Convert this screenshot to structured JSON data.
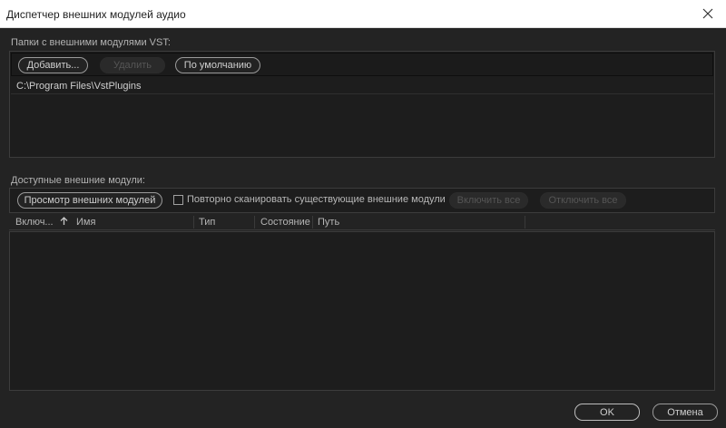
{
  "window": {
    "title": "Диспетчер внешних модулей аудио",
    "close_icon": "close-icon"
  },
  "vst_folders": {
    "label": "Папки с внешними модулями VST:",
    "buttons": {
      "add": "Добавить...",
      "remove": "Удалить",
      "default": "По умолчанию"
    },
    "items": [
      "C:\\Program Files\\VstPlugins"
    ]
  },
  "available_plugins": {
    "label": "Доступные внешние модули:",
    "buttons": {
      "scan": "Просмотр внешних модулей",
      "enable_all": "Включить все",
      "disable_all": "Отключить все"
    },
    "rescan_checkbox": {
      "label": "Повторно сканировать существующие внешние модули",
      "checked": false
    },
    "columns": {
      "enabled": "Включ...",
      "name": "Имя",
      "type": "Тип",
      "status": "Состояние",
      "path": "Путь"
    },
    "sort_icon": "arrow-up-icon",
    "rows": []
  },
  "footer": {
    "ok": "OK",
    "cancel": "Отмена"
  },
  "colors": {
    "background": "#232323",
    "panel": "#1d1d1d",
    "titlebar": "#ffffff"
  }
}
